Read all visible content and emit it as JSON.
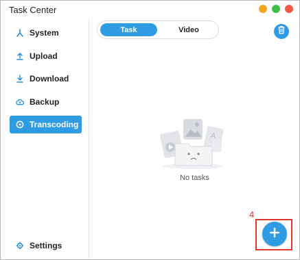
{
  "window": {
    "title": "Task Center"
  },
  "sidebar": {
    "items": [
      {
        "label": "System",
        "icon": "system-icon"
      },
      {
        "label": "Upload",
        "icon": "upload-icon"
      },
      {
        "label": "Download",
        "icon": "download-icon"
      },
      {
        "label": "Backup",
        "icon": "cloud-icon"
      },
      {
        "label": "Transcoding",
        "icon": "transcode-icon",
        "active": true
      }
    ],
    "settings_label": "Settings"
  },
  "main": {
    "tabs": [
      {
        "label": "Task",
        "active": true
      },
      {
        "label": "Video",
        "active": false
      }
    ],
    "empty_text": "No tasks"
  },
  "annotation": {
    "number": "4"
  },
  "colors": {
    "accent": "#2f9be3",
    "annotation": "#e0362c"
  }
}
